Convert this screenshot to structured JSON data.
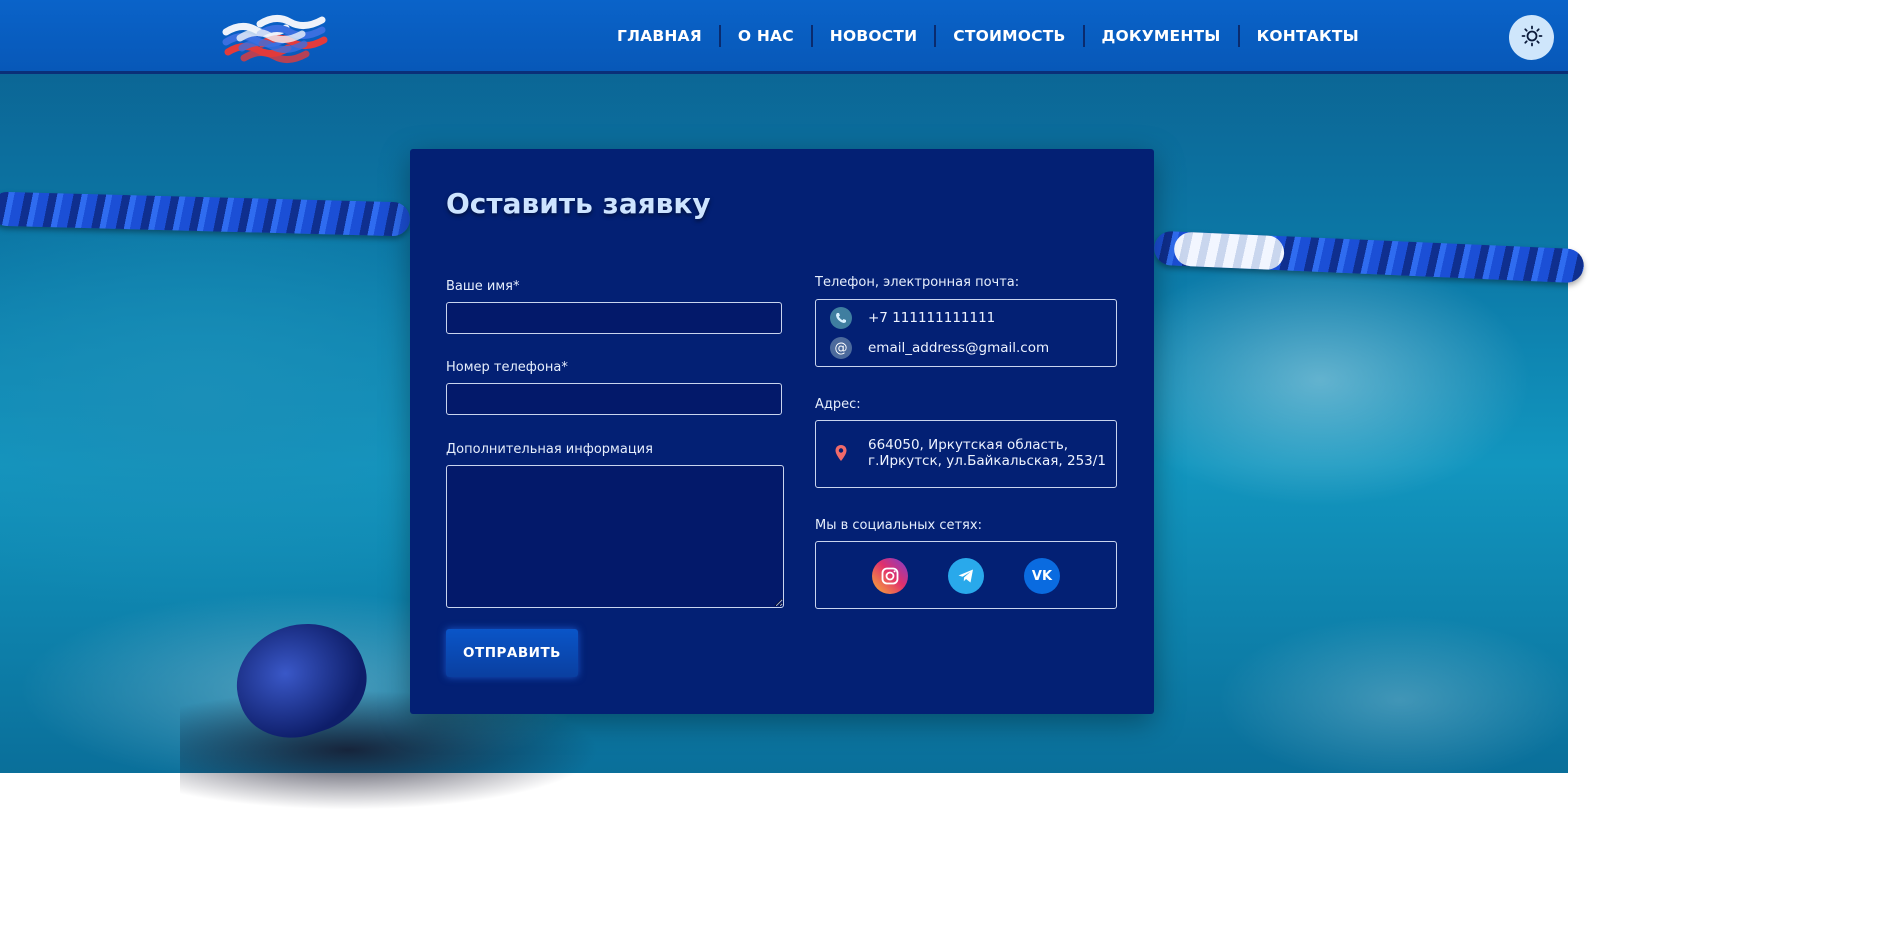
{
  "nav": {
    "items": [
      {
        "label": "ГЛАВНАЯ"
      },
      {
        "label": "О НАС"
      },
      {
        "label": "НОВОСТИ"
      },
      {
        "label": "СТОИМОСТЬ"
      },
      {
        "label": "ДОКУМЕНТЫ"
      },
      {
        "label": "КОНТАКТЫ"
      }
    ],
    "theme_icon": "sun-icon"
  },
  "form": {
    "title": "Оставить заявку",
    "name_label": "Ваше имя*",
    "name_value": "",
    "phone_label": "Номер телефона*",
    "phone_value": "",
    "info_label": "Дополнительная информация",
    "info_value": "",
    "submit_label": "ОТПРАВИТЬ"
  },
  "contacts": {
    "contacts_label": "Телефон, электронная почта:",
    "phone": "+7 111111111111",
    "email": "email_address@gmail.com",
    "address_label": "Адрес:",
    "address_line1": "664050, Иркутская область,",
    "address_line2": "г.Иркутск, ул.Байкальская, 253/1",
    "social_label": "Мы в социальных сетях:",
    "social": [
      {
        "icon": "instagram-icon",
        "color": "#e1306c"
      },
      {
        "icon": "telegram-icon",
        "color": "#29a9eb"
      },
      {
        "icon": "vk-icon",
        "color": "#0a6be0",
        "text": "VK"
      }
    ]
  },
  "colors": {
    "header": "#0a63c9",
    "card": "#032074",
    "title": "#cde4ff",
    "location_pin": "#f06a6a"
  }
}
